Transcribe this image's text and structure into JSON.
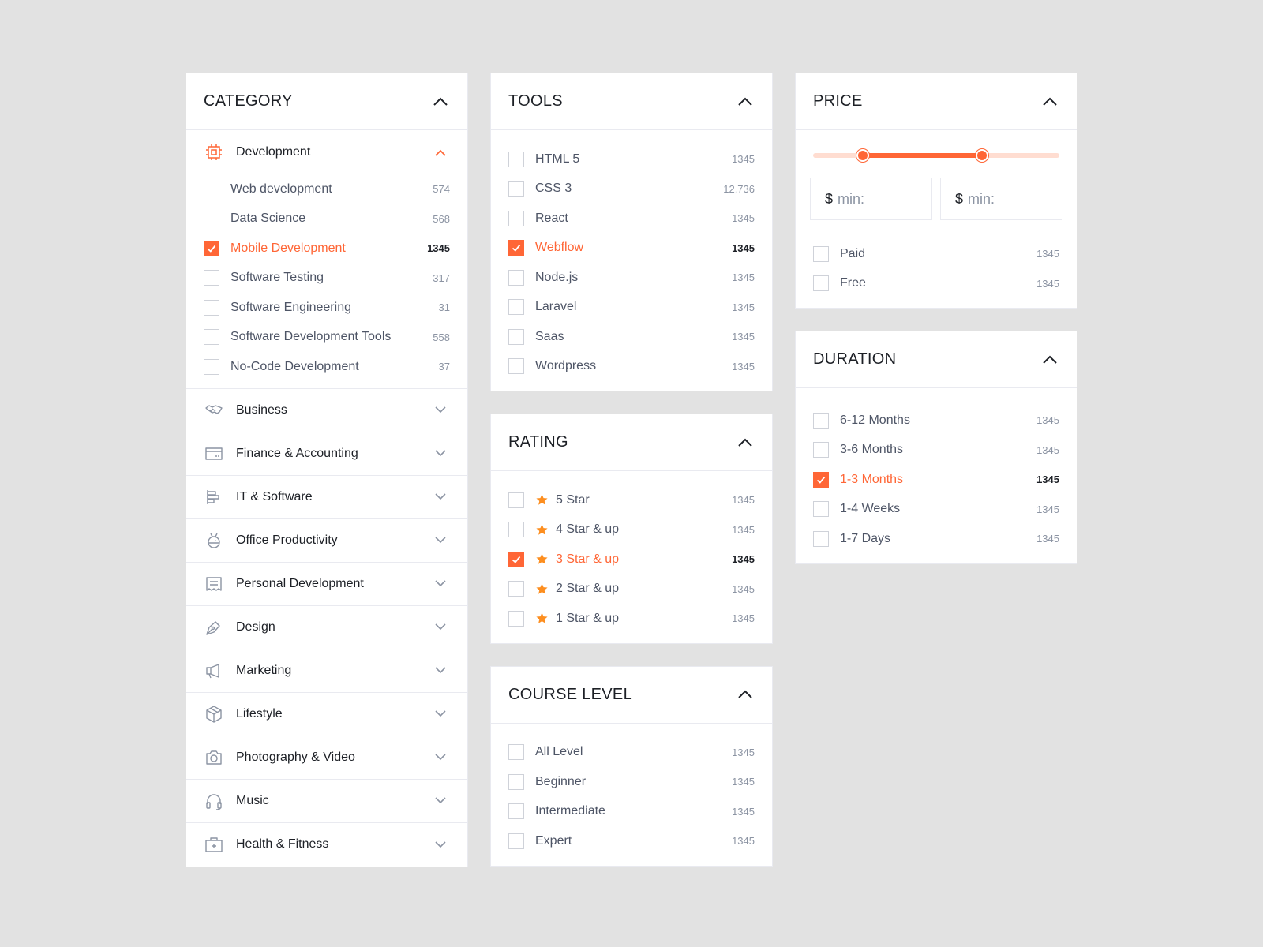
{
  "colors": {
    "accent": "#ff6636",
    "accent_light": "#ffddd1",
    "text": "#1d2026",
    "muted": "#8c94a3",
    "border": "#e9eaf0"
  },
  "category": {
    "title": "CATEGORY",
    "open": {
      "label": "Development",
      "icon": "chip-icon",
      "items": [
        {
          "label": "Web development",
          "count": "574",
          "checked": false
        },
        {
          "label": "Data Science",
          "count": "568",
          "checked": false
        },
        {
          "label": "Mobile Development",
          "count": "1345",
          "checked": true
        },
        {
          "label": "Software Testing",
          "count": "317",
          "checked": false
        },
        {
          "label": "Software Engineering",
          "count": "31",
          "checked": false
        },
        {
          "label": "Software Development Tools",
          "count": "558",
          "checked": false
        },
        {
          "label": "No-Code Development",
          "count": "37",
          "checked": false
        }
      ]
    },
    "collapsed": [
      {
        "label": "Business",
        "icon": "handshake-icon"
      },
      {
        "label": "Finance & Accounting",
        "icon": "credit-card-icon"
      },
      {
        "label": "IT & Software",
        "icon": "align-left-icon"
      },
      {
        "label": "Office Productivity",
        "icon": "robot-icon"
      },
      {
        "label": "Personal Development",
        "icon": "receipt-icon"
      },
      {
        "label": "Design",
        "icon": "pen-nib-icon"
      },
      {
        "label": "Marketing",
        "icon": "megaphone-icon"
      },
      {
        "label": "Lifestyle",
        "icon": "package-icon"
      },
      {
        "label": "Photography & Video",
        "icon": "camera-icon"
      },
      {
        "label": "Music",
        "icon": "headphones-icon"
      },
      {
        "label": "Health & Fitness",
        "icon": "first-aid-kit-icon"
      }
    ]
  },
  "tools": {
    "title": "TOOLS",
    "items": [
      {
        "label": "HTML 5",
        "count": "1345",
        "checked": false
      },
      {
        "label": "CSS 3",
        "count": "12,736",
        "checked": false
      },
      {
        "label": "React",
        "count": "1345",
        "checked": false
      },
      {
        "label": "Webflow",
        "count": "1345",
        "checked": true
      },
      {
        "label": "Node.js",
        "count": "1345",
        "checked": false
      },
      {
        "label": "Laravel",
        "count": "1345",
        "checked": false
      },
      {
        "label": "Saas",
        "count": "1345",
        "checked": false
      },
      {
        "label": "Wordpress",
        "count": "1345",
        "checked": false
      }
    ]
  },
  "rating": {
    "title": "RATING",
    "items": [
      {
        "label": "5 Star",
        "count": "1345",
        "checked": false
      },
      {
        "label": "4 Star & up",
        "count": "1345",
        "checked": false
      },
      {
        "label": "3 Star & up",
        "count": "1345",
        "checked": true
      },
      {
        "label": "2 Star & up",
        "count": "1345",
        "checked": false
      },
      {
        "label": "1 Star & up",
        "count": "1345",
        "checked": false
      }
    ]
  },
  "course_level": {
    "title": "COURSE LEVEL",
    "items": [
      {
        "label": "All Level",
        "count": "1345",
        "checked": false
      },
      {
        "label": "Beginner",
        "count": "1345",
        "checked": false
      },
      {
        "label": "Intermediate",
        "count": "1345",
        "checked": false
      },
      {
        "label": "Expert",
        "count": "1345",
        "checked": false
      }
    ]
  },
  "price": {
    "title": "PRICE",
    "range_fraction": [
      0.2,
      0.68
    ],
    "min_currency": "$",
    "min_placeholder": "min:",
    "max_currency": "$",
    "max_placeholder": "min:",
    "items": [
      {
        "label": "Paid",
        "count": "1345",
        "checked": false
      },
      {
        "label": "Free",
        "count": "1345",
        "checked": false
      }
    ]
  },
  "duration": {
    "title": "DURATION",
    "items": [
      {
        "label": "6-12 Months",
        "count": "1345",
        "checked": false
      },
      {
        "label": "3-6 Months",
        "count": "1345",
        "checked": false
      },
      {
        "label": "1-3 Months",
        "count": "1345",
        "checked": true
      },
      {
        "label": "1-4 Weeks",
        "count": "1345",
        "checked": false
      },
      {
        "label": "1-7 Days",
        "count": "1345",
        "checked": false
      }
    ]
  }
}
